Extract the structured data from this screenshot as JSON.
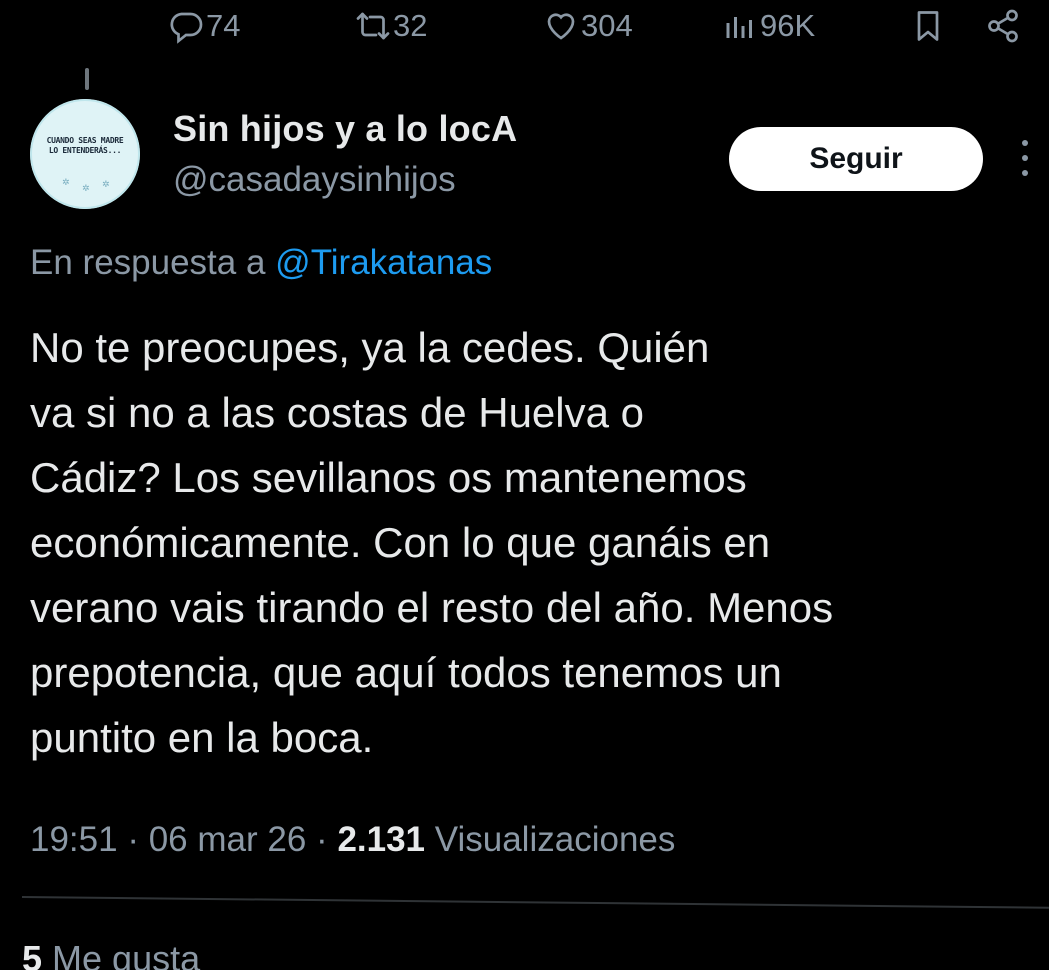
{
  "actions": {
    "replies": "74",
    "retweets": "32",
    "likes": "304",
    "views": "96K"
  },
  "author": {
    "display_name": "Sin hijos y a lo locA",
    "handle": "@casadaysinhijos",
    "avatar_text_line1": "CUANDO SEAS MADRE",
    "avatar_text_line2": "LO ENTENDERÁS..."
  },
  "follow_button": {
    "label": "Seguir"
  },
  "reply_context": {
    "prefix": "En respuesta a",
    "mention": "@Tirakatanas"
  },
  "tweet": {
    "lines": [
      "No te preocupes, ya la cedes. Quién",
      "va si no a las costas de Huelva o",
      "Cádiz? Los sevillanos os mantenemos",
      "económicamente. Con lo que ganáis en",
      "verano vais tirando el resto del año. Menos",
      "prepotencia, que aquí todos tenemos un",
      "puntito en la boca."
    ]
  },
  "meta": {
    "time": "19:51",
    "separator": "·",
    "date": "06 mar 26",
    "views_count": "2.131",
    "views_label": "Visualizaciones"
  },
  "engagement": {
    "likes_count": "5",
    "likes_label": "Me gusta"
  },
  "colors": {
    "background": "#000000",
    "text": "#e7e9ea",
    "secondary": "#8b98a5",
    "link": "#1d9bf0"
  }
}
